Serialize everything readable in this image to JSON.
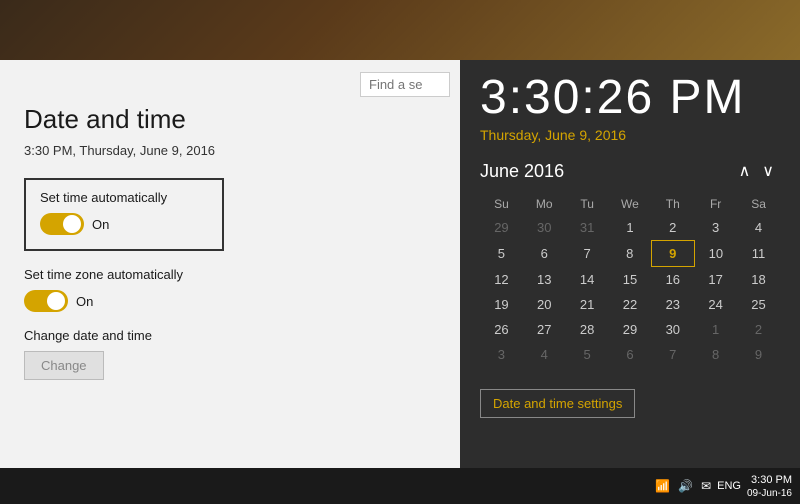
{
  "topbar": {
    "background_desc": "gradient image bar"
  },
  "search": {
    "placeholder": "Find a se",
    "value": ""
  },
  "settings": {
    "title": "Date and time",
    "current_datetime": "3:30 PM, Thursday, June 9, 2016",
    "set_time_auto_label": "Set time automatically",
    "set_time_auto_value": "On",
    "set_timezone_auto_label": "Set time zone automatically",
    "set_timezone_auto_value": "On",
    "change_datetime_label": "Change date and time",
    "change_btn_label": "Change"
  },
  "clock": {
    "time": "3:30:26 PM",
    "date": "Thursday, June 9, 2016"
  },
  "calendar": {
    "month_year": "June 2016",
    "days_of_week": [
      "Su",
      "Mo",
      "Tu",
      "We",
      "Th",
      "Fr",
      "Sa"
    ],
    "weeks": [
      [
        {
          "day": "29",
          "other": true
        },
        {
          "day": "30",
          "other": true
        },
        {
          "day": "31",
          "other": true
        },
        {
          "day": "1",
          "other": false
        },
        {
          "day": "2",
          "other": false
        },
        {
          "day": "3",
          "other": false
        },
        {
          "day": "4",
          "other": false
        }
      ],
      [
        {
          "day": "5",
          "other": false
        },
        {
          "day": "6",
          "other": false
        },
        {
          "day": "7",
          "other": false
        },
        {
          "day": "8",
          "other": false
        },
        {
          "day": "9",
          "other": false,
          "today": true
        },
        {
          "day": "10",
          "other": false
        },
        {
          "day": "11",
          "other": false
        }
      ],
      [
        {
          "day": "12",
          "other": false
        },
        {
          "day": "13",
          "other": false
        },
        {
          "day": "14",
          "other": false
        },
        {
          "day": "15",
          "other": false
        },
        {
          "day": "16",
          "other": false
        },
        {
          "day": "17",
          "other": false
        },
        {
          "day": "18",
          "other": false
        }
      ],
      [
        {
          "day": "19",
          "other": false
        },
        {
          "day": "20",
          "other": false
        },
        {
          "day": "21",
          "other": false
        },
        {
          "day": "22",
          "other": false
        },
        {
          "day": "23",
          "other": false
        },
        {
          "day": "24",
          "other": false
        },
        {
          "day": "25",
          "other": false
        }
      ],
      [
        {
          "day": "26",
          "other": false
        },
        {
          "day": "27",
          "other": false
        },
        {
          "day": "28",
          "other": false
        },
        {
          "day": "29",
          "other": false
        },
        {
          "day": "30",
          "other": false
        },
        {
          "day": "1",
          "other": true
        },
        {
          "day": "2",
          "other": true
        }
      ],
      [
        {
          "day": "3",
          "other": true
        },
        {
          "day": "4",
          "other": true
        },
        {
          "day": "5",
          "other": true
        },
        {
          "day": "6",
          "other": true
        },
        {
          "day": "7",
          "other": true
        },
        {
          "day": "8",
          "other": true
        },
        {
          "day": "9",
          "other": true
        }
      ]
    ],
    "date_time_settings_label": "Date and time settings"
  },
  "taskbar": {
    "lang": "ENG",
    "time": "3:30 PM",
    "date": "09-Jun-16"
  }
}
